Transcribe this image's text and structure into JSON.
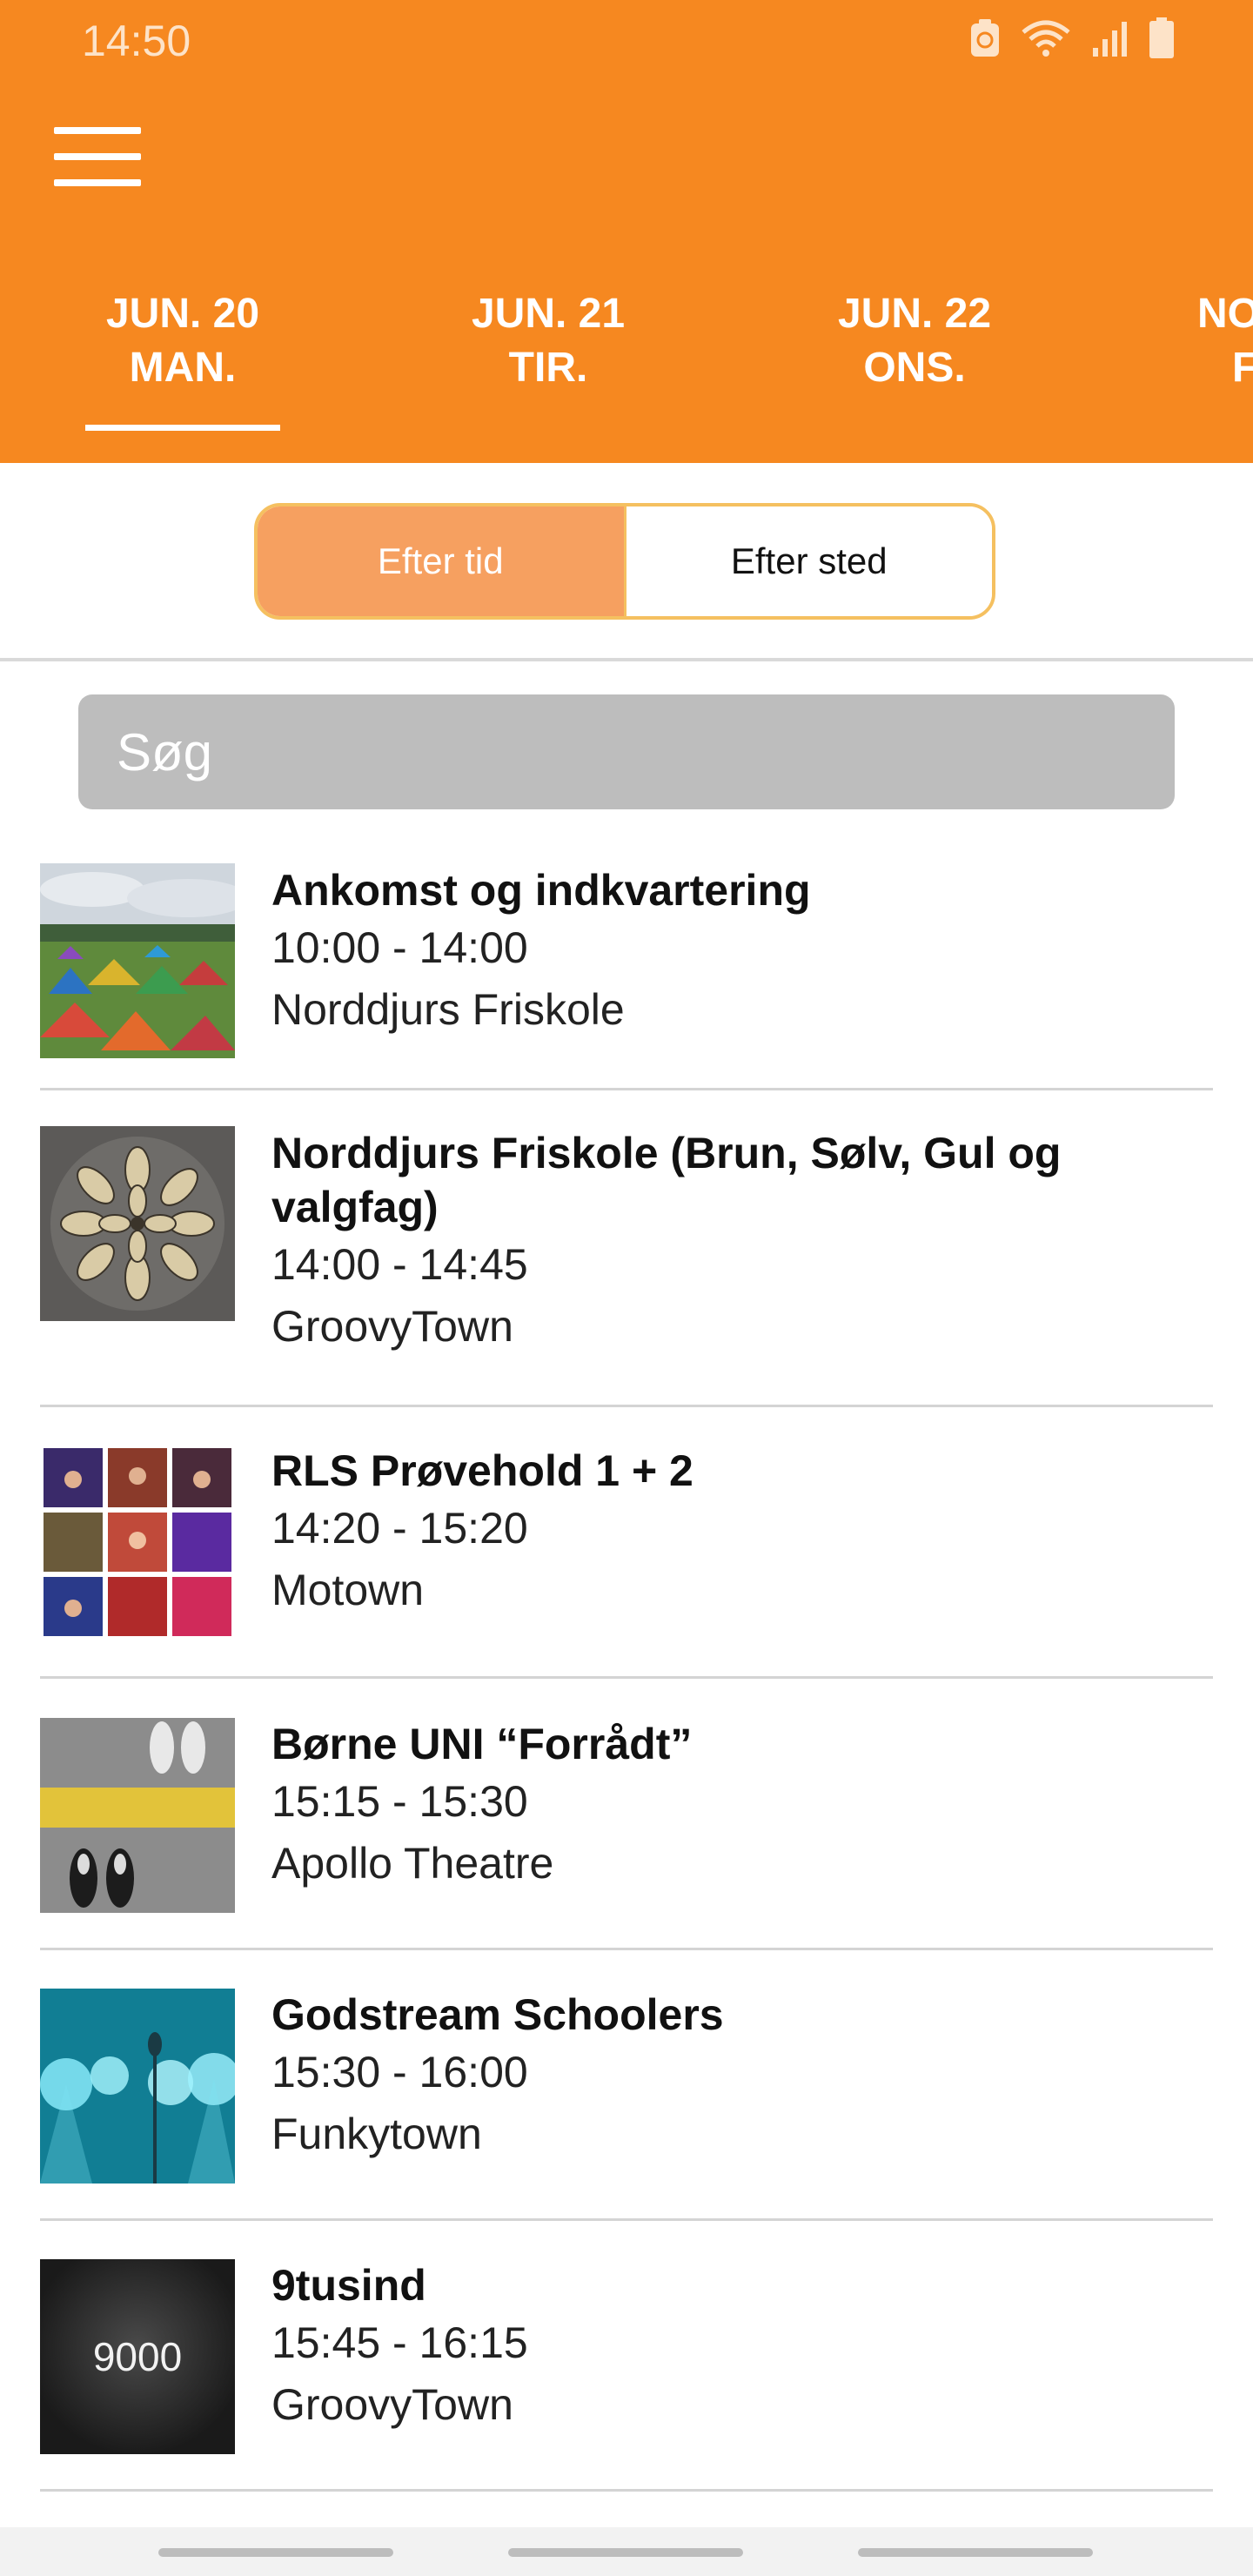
{
  "status_bar": {
    "time": "14:50",
    "icons": [
      "data-saver-icon",
      "wifi-icon",
      "signal-icon",
      "battery-icon"
    ]
  },
  "header": {
    "menu_icon": "hamburger-menu-icon",
    "background": "#f68820"
  },
  "tabs": [
    {
      "line1": "JUN. 20",
      "line2": "MAN.",
      "selected": true
    },
    {
      "line1": "JUN. 21",
      "line2": "TIR.",
      "selected": false
    },
    {
      "line1": "JUN. 22",
      "line2": "ONS.",
      "selected": false
    },
    {
      "line1": "NO",
      "line2": "F",
      "selected": false
    }
  ],
  "segment": {
    "by_time": "Efter tid",
    "by_place": "Efter sted",
    "active": "by_time"
  },
  "search": {
    "placeholder": "Søg"
  },
  "events": [
    {
      "title": "Ankomst og indkvartering",
      "time": "10:00 - 14:00",
      "venue": "Norddjurs Friskole",
      "thumb": "campsite-tents-photo"
    },
    {
      "title": "Norddjurs Friskole (Brun, Sølv, Gul og valgfag)",
      "time": "14:00 - 14:45",
      "venue": "GroovyTown",
      "thumb": "spiral-sculpture-photo"
    },
    {
      "title": "RLS Prøvehold 1 + 2",
      "time": "14:20 - 15:20",
      "venue": "Motown",
      "thumb": "concert-collage-photo"
    },
    {
      "title": "Børne UNI “Forrådt”",
      "time": "15:15 - 15:30",
      "venue": "Apollo Theatre",
      "thumb": "shoes-on-yellow-line-photo"
    },
    {
      "title": "Godstream Schoolers",
      "time": "15:30 - 16:00",
      "venue": "Funkytown",
      "thumb": "stage-lights-microphone-photo"
    },
    {
      "title": "9tusind",
      "time": "15:45 - 16:15",
      "venue": "GroovyTown",
      "thumb": "9000-logo",
      "thumb_text": "9000"
    }
  ]
}
